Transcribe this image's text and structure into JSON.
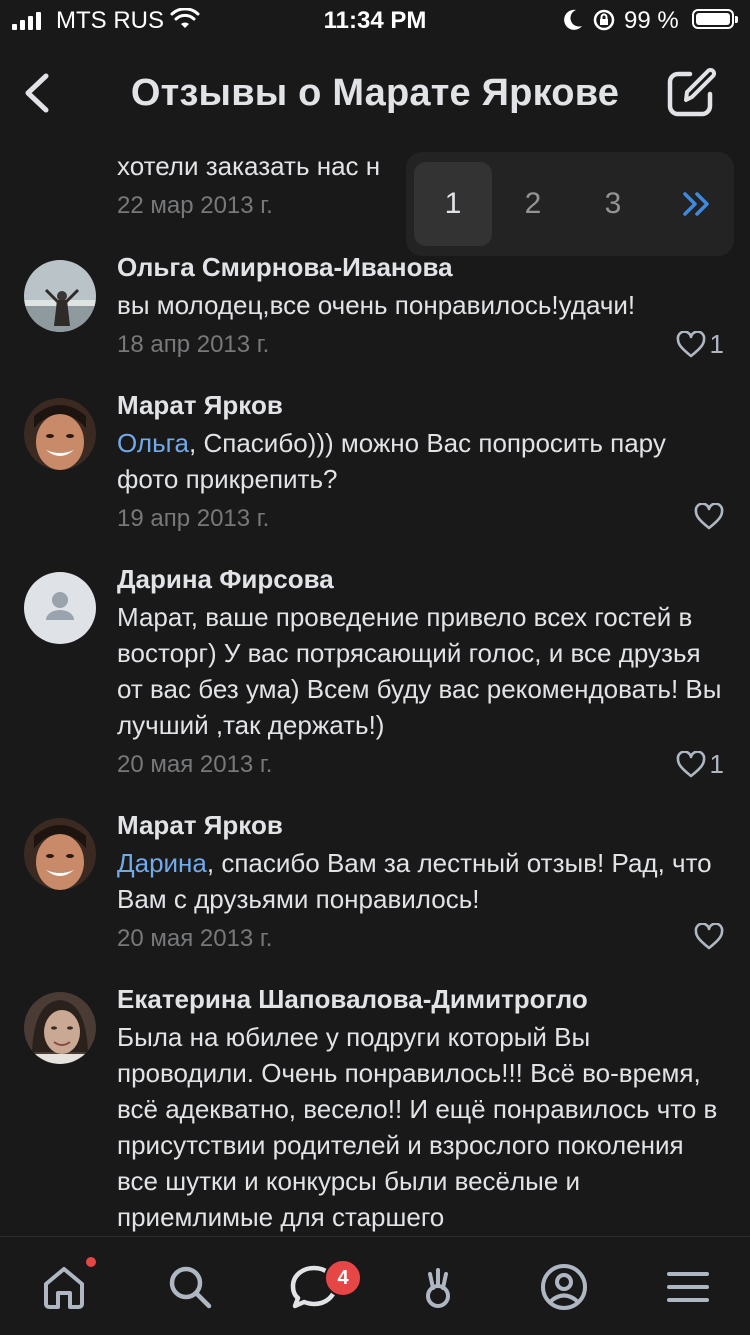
{
  "status": {
    "carrier": "MTS RUS",
    "time": "11:34 PM",
    "battery": "99 %",
    "battery_level": 0.99
  },
  "header": {
    "title": "Отзывы о Марате Яркове"
  },
  "partial_comment": {
    "text": "хотели заказать нас н",
    "date": "22 мар 2013 г."
  },
  "pager": {
    "pages": [
      "1",
      "2",
      "3"
    ],
    "active": "1"
  },
  "comments": [
    {
      "author": "Ольга Смирнова-Иванова",
      "text": "вы молодец,все очень понравилось!удачи!",
      "date": "18 апр 2013 г.",
      "likes": "1"
    },
    {
      "author": "Марат Ярков",
      "mention": "Ольга",
      "text": ", Спасибо))) можно Вас попросить пару фото прикрепить?",
      "date": "19 апр 2013 г.",
      "likes": ""
    },
    {
      "author": "Дарина Фирсова",
      "text": "Марат, ваше проведение привело всех гостей в восторг) У вас потрясающий голос, и все друзья от вас без ума) Всем буду вас рекомендовать! Вы лучший ,так держать!)",
      "date": "20 мая 2013 г.",
      "likes": "1"
    },
    {
      "author": "Марат Ярков",
      "mention": "Дарина",
      "text": ", спасибо Вам за лестный отзыв! Рад, что Вам с друзьями понравилось!",
      "date": "20 мая 2013 г.",
      "likes": ""
    },
    {
      "author": "Екатерина Шаповалова-Димитрогло",
      "text": "Была на юбилее у подруги который Вы проводили. Очень понравилось!!! Всё во-время, всё адекватно, весело!! И ещё понравилось что в присутствии родителей и взрослого поколения все шутки и конкурсы были весёлые и приемлимые для старшего"
    }
  ],
  "tabbar": {
    "messages_badge": "4",
    "icons": [
      "home-icon",
      "search-icon",
      "messages-icon",
      "services-icon",
      "profile-icon",
      "menu-icon"
    ]
  },
  "colors": {
    "background": "#19191a",
    "accent": "#71aaeb",
    "badge": "#e64646"
  }
}
